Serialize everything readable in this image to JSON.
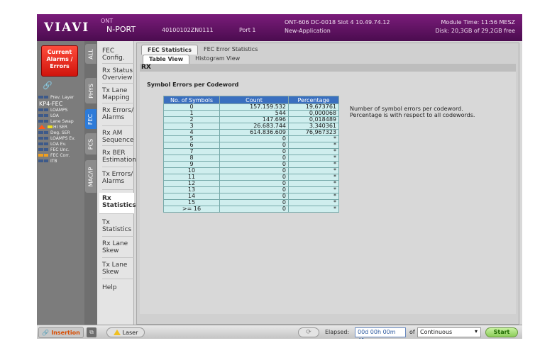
{
  "header": {
    "logo": "VIAVI",
    "product_line1": "ONT",
    "product_line2": "N-PORT",
    "serial": "40100102ZN0111",
    "port": "Port 1",
    "device_info": "ONT-606 DC-0018 Slot 4  10.49.74.12",
    "application": "New-Application",
    "module_time": "Module Time: 11:56 MESZ",
    "disk": "Disk: 20,3GB of 29,2GB free"
  },
  "alarm_panel": {
    "current_alarms_label": "Current Alarms / Errors",
    "prev_layer_label": "Prev. Layer",
    "layer_name": "KP4-FEC",
    "items": [
      "LOAMPS",
      "LOA",
      "Lane Swap",
      "HI SER",
      "Deg. SER",
      "LOAMPS Ev.",
      "LOA Ev.",
      "FEC Unc.",
      "FEC Corr.",
      "ITB"
    ],
    "colors": {
      "alarm_red": "#e0281a",
      "active_tab": "#2d7bd9"
    }
  },
  "vertical_tabs": [
    "ALL",
    "PHYS",
    "FEC",
    "PCS",
    "MAC/IP"
  ],
  "active_vertical_tab": "FEC",
  "nav": {
    "items": [
      "FEC Config.",
      "Rx Status Overview",
      "Tx Lane Mapping",
      "Rx Errors/ Alarms",
      "Rx AM Sequence",
      "Rx BER Estimation",
      "Tx Errors/ Alarms",
      "Rx Statistics",
      "Tx Statistics",
      "Rx Lane Skew",
      "Tx Lane Skew",
      "Help"
    ],
    "active": "Rx Statistics"
  },
  "tabs": {
    "top": [
      "FEC Statistics",
      "FEC Error Statistics"
    ],
    "sub": [
      "Table View",
      "Histogram View"
    ]
  },
  "section_bar": "RX",
  "table_title": "Symbol Errors per Codeword",
  "table": {
    "headers": [
      "No. of Symbols",
      "Count",
      "Percentage"
    ],
    "rows": [
      [
        "0",
        "157.159.532",
        "19,673761"
      ],
      [
        "1",
        "544",
        "0,000068"
      ],
      [
        "2",
        "147.696",
        "0,018489"
      ],
      [
        "3",
        "26.683.744",
        "3,340361"
      ],
      [
        "4",
        "614.836.609",
        "76,967323"
      ],
      [
        "5",
        "0",
        "*"
      ],
      [
        "6",
        "0",
        "*"
      ],
      [
        "7",
        "0",
        "*"
      ],
      [
        "8",
        "0",
        "*"
      ],
      [
        "9",
        "0",
        "*"
      ],
      [
        "10",
        "0",
        "*"
      ],
      [
        "11",
        "0",
        "*"
      ],
      [
        "12",
        "0",
        "*"
      ],
      [
        "13",
        "0",
        "*"
      ],
      [
        "14",
        "0",
        "*"
      ],
      [
        "15",
        "0",
        "*"
      ],
      [
        ">= 16",
        "0",
        "*"
      ]
    ]
  },
  "description": [
    "Number of symbol errors per codeword.",
    "Percentage is with respect to all codewords."
  ],
  "footer": {
    "insertion": "Insertion",
    "laser": "Laser",
    "elapsed_label": "Elapsed:",
    "elapsed_value": "00d 00h 00m 41s",
    "of_label": "of",
    "mode": "Continuous",
    "start": "Start"
  }
}
